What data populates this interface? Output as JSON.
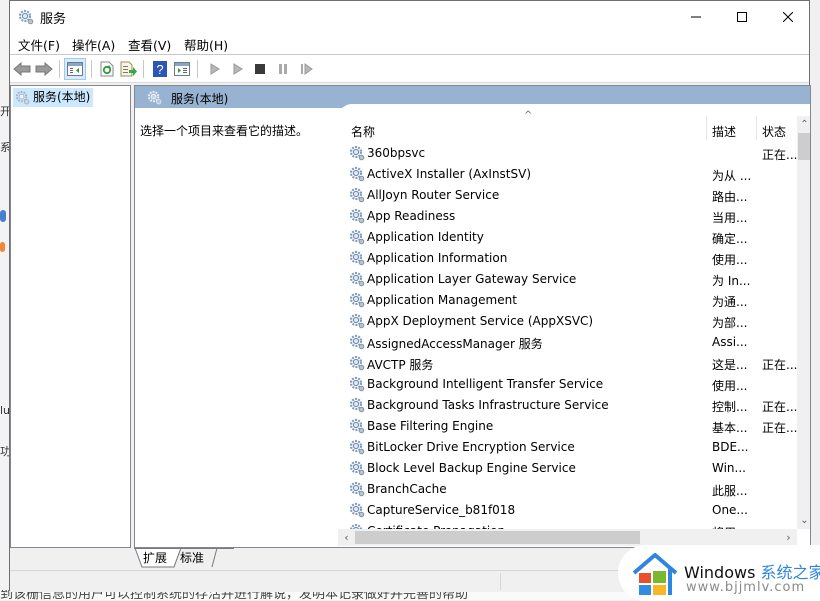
{
  "window": {
    "title": "服务",
    "controls": {
      "minimize": "minimize",
      "maximize": "maximize",
      "close": "close"
    }
  },
  "menu": [
    "文件(F)",
    "操作(A)",
    "查看(V)",
    "帮助(H)"
  ],
  "toolbar": {
    "buttons": [
      "back",
      "forward",
      "show-hide-console-tree",
      "refresh",
      "export-list",
      "help",
      "properties",
      "start",
      "start-with-params",
      "stop",
      "pause",
      "resume"
    ]
  },
  "tree": {
    "root_label": "服务(本地)"
  },
  "content": {
    "header_label": "服务(本地)",
    "description_prompt": "选择一个项目来查看它的描述。",
    "columns": {
      "name": "名称",
      "description": "描述",
      "status": "状态"
    },
    "services": [
      {
        "name": "360bpsvc",
        "description": "",
        "status": "正在..."
      },
      {
        "name": "ActiveX Installer (AxInstSV)",
        "description": "为从 ...",
        "status": ""
      },
      {
        "name": "AllJoyn Router Service",
        "description": "路由...",
        "status": ""
      },
      {
        "name": "App Readiness",
        "description": "当用...",
        "status": ""
      },
      {
        "name": "Application Identity",
        "description": "确定...",
        "status": ""
      },
      {
        "name": "Application Information",
        "description": "使用...",
        "status": ""
      },
      {
        "name": "Application Layer Gateway Service",
        "description": "为 In...",
        "status": ""
      },
      {
        "name": "Application Management",
        "description": "为通...",
        "status": ""
      },
      {
        "name": "AppX Deployment Service (AppXSVC)",
        "description": "为部...",
        "status": ""
      },
      {
        "name": "AssignedAccessManager 服务",
        "description": "Assi...",
        "status": ""
      },
      {
        "name": "AVCTP 服务",
        "description": "这是...",
        "status": "正在..."
      },
      {
        "name": "Background Intelligent Transfer Service",
        "description": "使用...",
        "status": ""
      },
      {
        "name": "Background Tasks Infrastructure Service",
        "description": "控制...",
        "status": "正在..."
      },
      {
        "name": "Base Filtering Engine",
        "description": "基本...",
        "status": "正在..."
      },
      {
        "name": "BitLocker Drive Encryption Service",
        "description": "BDE...",
        "status": ""
      },
      {
        "name": "Block Level Backup Engine Service",
        "description": "Win...",
        "status": ""
      },
      {
        "name": "BranchCache",
        "description": "此服...",
        "status": ""
      },
      {
        "name": "CaptureService_b81f018",
        "description": "One...",
        "status": ""
      },
      {
        "name": "Certificate Propagation",
        "description": "将用...",
        "status": ""
      }
    ]
  },
  "tabs": [
    "扩展",
    "标准"
  ],
  "active_tab": "扩展",
  "watermark": {
    "brand_en": "Windows",
    "brand_cn": "系统之家",
    "url": "www.bjjmlv.com"
  },
  "background": {
    "bottom_text": "到该栅信息的用户可以控制系统的存活并进行解说，发明本记录做好并完善的帮助"
  },
  "colors": {
    "header_band": "#98b3d1",
    "selection": "#cce8ff",
    "scroll_thumb": "#cdcdcd"
  }
}
